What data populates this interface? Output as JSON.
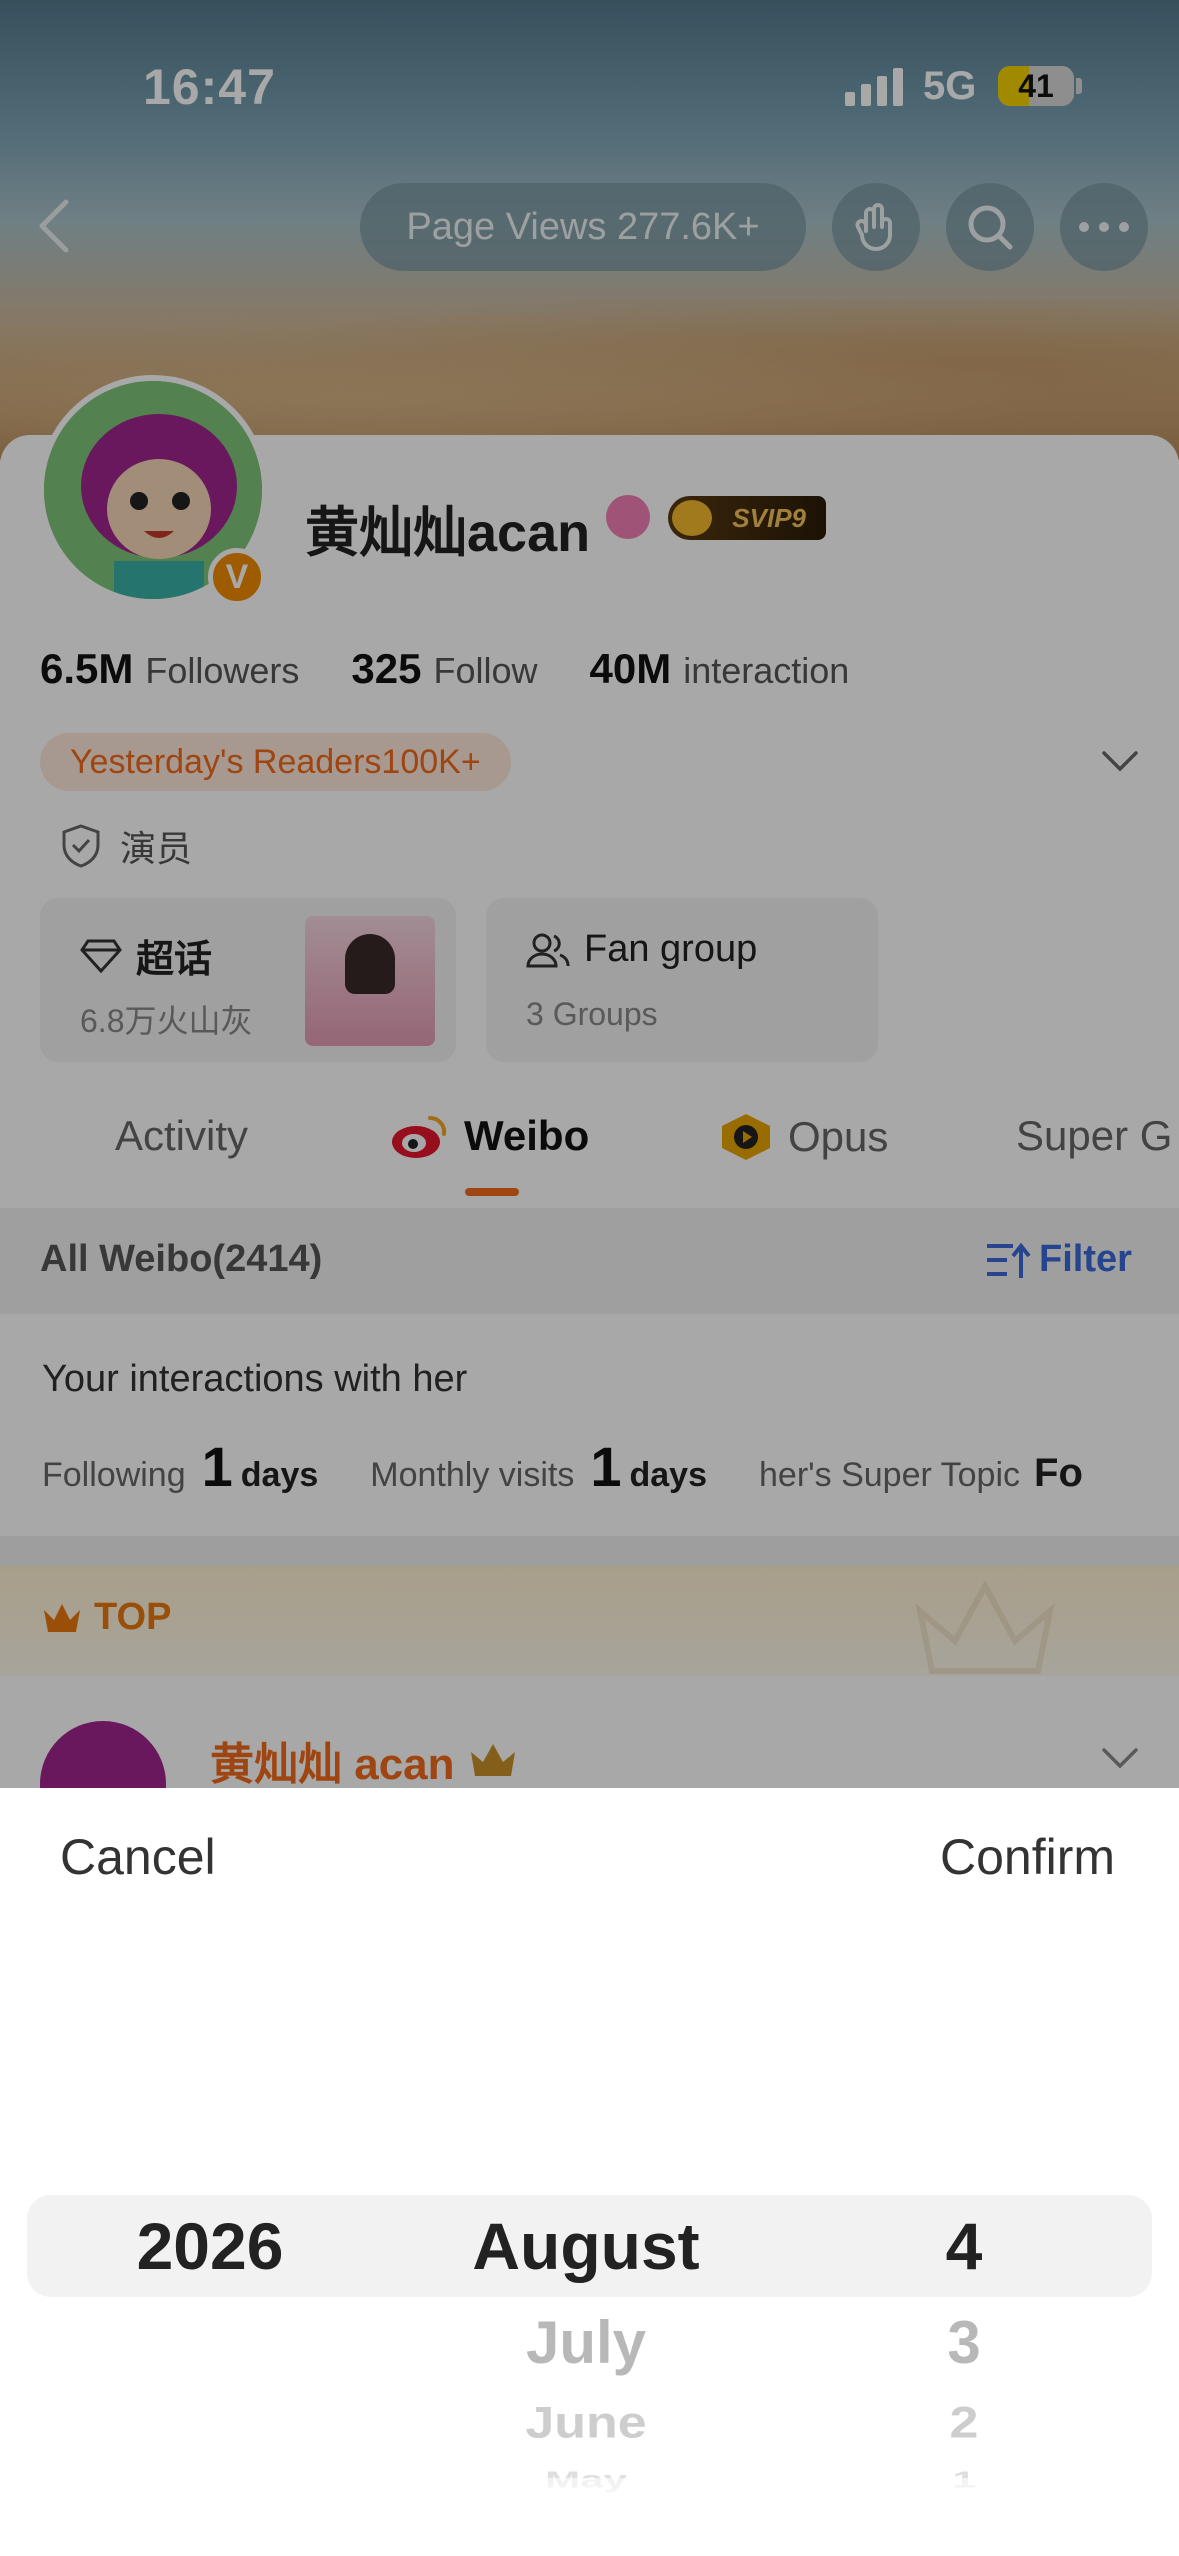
{
  "status_bar": {
    "time": "16:47",
    "network": "5G",
    "battery": "41",
    "battery_level": 0.41
  },
  "header": {
    "page_views": "Page Views 277.6K+"
  },
  "profile": {
    "name": "黄灿灿acan",
    "badge_svip": "SVIP9",
    "stats": [
      {
        "value": "6.5M",
        "label": "Followers"
      },
      {
        "value": "325",
        "label": "Follow"
      },
      {
        "value": "40M",
        "label": "interaction"
      }
    ],
    "readers_tag": "Yesterday's Readers100K+",
    "role": "演员",
    "super_topic": {
      "title": "超话",
      "subtitle": "6.8万火山灰"
    },
    "fan_group": {
      "title": "Fan group",
      "subtitle": "3 Groups"
    }
  },
  "tabs": [
    {
      "label": "Activity"
    },
    {
      "label": "Weibo"
    },
    {
      "label": "Opus"
    },
    {
      "label": "Super G"
    }
  ],
  "feed": {
    "all_weibo": "All Weibo(2414)",
    "filter": "Filter",
    "interactions_title": "Your interactions with her",
    "following_label": "Following",
    "following_value": "1",
    "following_unit": "days",
    "visits_label": "Monthly visits",
    "visits_value": "1",
    "visits_unit": "days",
    "super_topic_label": "her's Super Topic",
    "super_topic_value": "Fo",
    "top_label": "TOP",
    "post_author": "黄灿灿 acan"
  },
  "picker": {
    "cancel": "Cancel",
    "confirm": "Confirm",
    "year": {
      "selected": "2026"
    },
    "month": {
      "selected": "August",
      "below": [
        "July",
        "June",
        "May"
      ]
    },
    "day": {
      "selected": "4",
      "below": [
        "3",
        "2",
        "1"
      ]
    }
  },
  "colors": {
    "accent": "#f06a1b",
    "link_blue": "#3a6ad8",
    "battery": "#f5d100"
  }
}
